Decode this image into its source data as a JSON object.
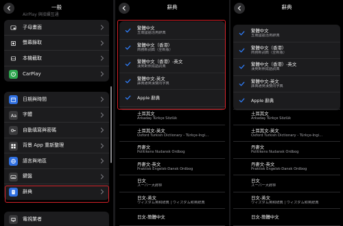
{
  "panel1": {
    "title": "一般",
    "top_partial": "AirPlay 與接續互通",
    "group1": [
      {
        "label": "子母畫面",
        "icon": "picture-in-picture-icon",
        "color": "#1c1c1e"
      },
      {
        "label": "螢幕錄取",
        "icon": "screen-recording-icon",
        "color": "#1c1c1e"
      },
      {
        "label": "本機截取",
        "icon": "storage-icon",
        "color": "#1c1c1e"
      },
      {
        "label": "CarPlay",
        "icon": "carplay-icon",
        "color": "#2ea84f"
      }
    ],
    "group2": [
      {
        "label": "日期與時間",
        "icon": "calendar-clock-icon",
        "color": "#2f6fe0"
      },
      {
        "label": "字體",
        "icon": "font-icon",
        "color": "#3a3a3c"
      },
      {
        "label": "自動填寫與密碼",
        "icon": "key-icon",
        "color": "#3a3a3c"
      },
      {
        "label": "背景 App 重新整理",
        "icon": "refresh-icon",
        "color": "#3a3a3c"
      },
      {
        "label": "語言與地區",
        "icon": "globe-icon",
        "color": "#2f6fe0"
      },
      {
        "label": "鍵盤",
        "icon": "keyboard-icon",
        "color": "#3a3a3c"
      },
      {
        "label": "辭典",
        "icon": "dictionary-icon",
        "color": "#2f6fe0"
      }
    ],
    "bottom_item": "電視業者"
  },
  "panel2": {
    "title": "辭典",
    "selected": [
      {
        "title": "繁體中文",
        "subtitle": "五南國語活用辭典"
      },
      {
        "title": "繁體中文（香港）",
        "subtitle": "商務新詞典（全新版）"
      },
      {
        "title": "繁體中文（香港）-英文",
        "subtitle": "漢英對照成語詞典"
      },
      {
        "title": "繁體中文-英文",
        "subtitle": "譯典通英漢雙向字典"
      },
      {
        "title": "Apple 辭典",
        "subtitle": ""
      }
    ],
    "others": [
      {
        "title": "土耳其文",
        "subtitle": "Arkadaş Türkçe Sözlük"
      },
      {
        "title": "土耳其文-英文",
        "subtitle": "Oxford Turkish Dictionary - Türkçe-İngi..."
      },
      {
        "title": "丹麥文",
        "subtitle": "Politikens Nudansk Ordbog"
      },
      {
        "title": "丹麥文-英文",
        "subtitle": "Praktisk Engelsk-Dansk Ordbog"
      },
      {
        "title": "日文",
        "subtitle": "スーパー大辞林"
      },
      {
        "title": "日文-英文",
        "subtitle": "ウィズダム英和辞典 | ウィズダム和英辞典"
      },
      {
        "title": "日文-簡體中文",
        "subtitle": ""
      }
    ]
  },
  "panel3": {
    "title": "辭典",
    "selected": [
      {
        "title": "繁體中文",
        "subtitle": "五南國語活用辭典"
      },
      {
        "title": "繁體中文（香港）",
        "subtitle": "商務新詞典（全新版）"
      },
      {
        "title": "繁體中文（香港）-英文",
        "subtitle": "漢英對照成語詞典"
      },
      {
        "title": "繁體中文-英文",
        "subtitle": "譯典通英漢雙向字典"
      },
      {
        "title": "Apple 辭典",
        "subtitle": ""
      }
    ],
    "others": [
      {
        "title": "土耳其文",
        "subtitle": "Arkadaş Türkçe Sözlük"
      },
      {
        "title": "土耳其文-英文",
        "subtitle": "Oxford Turkish Dictionary - Türkçe-İngi..."
      },
      {
        "title": "丹麥文",
        "subtitle": "Politikens Nudansk Ordbog"
      },
      {
        "title": "丹麥文-英文",
        "subtitle": "Praktisk Engelsk-Dansk Ordbog"
      },
      {
        "title": "日文",
        "subtitle": "スーパー大辞林"
      },
      {
        "title": "日文-英文",
        "subtitle": "ウィズダム英和辞典 | ウィズダム和英辞典"
      },
      {
        "title": "日文-簡體中文",
        "subtitle": ""
      }
    ]
  },
  "colors": {
    "accent": "#2f7cf6",
    "highlight": "#d8232a"
  }
}
